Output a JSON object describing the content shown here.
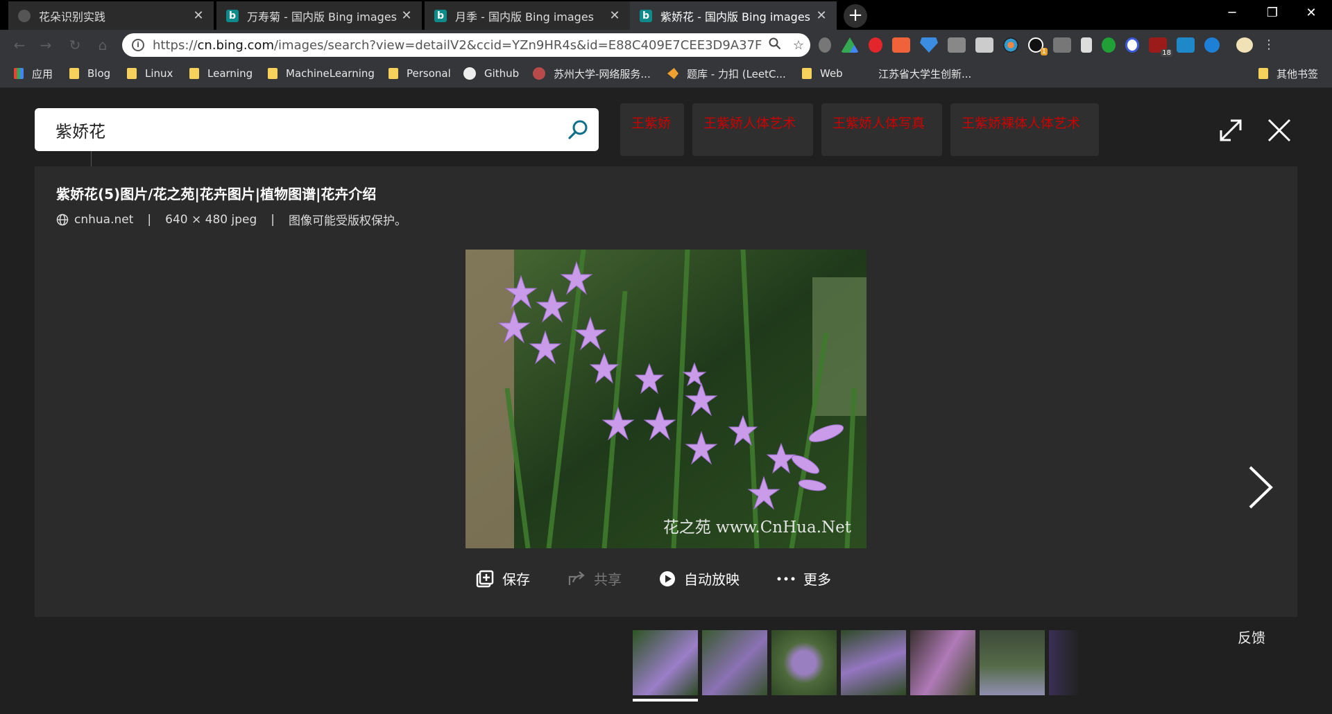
{
  "tabs": [
    {
      "title": "花朵识别实践",
      "icon": "blank-page-icon",
      "active": false
    },
    {
      "title": "万寿菊 - 国内版 Bing images",
      "icon": "bing-icon",
      "active": false
    },
    {
      "title": "月季 - 国内版 Bing images",
      "icon": "bing-icon",
      "active": false
    },
    {
      "title": "紫娇花 - 国内版 Bing images",
      "icon": "bing-icon",
      "active": true
    }
  ],
  "window": {
    "minimize": "─",
    "restore": "❐",
    "close": "✕"
  },
  "omnibox": {
    "url_scheme": "https://",
    "url_host": "cn.bing.com",
    "url_rest": "/images/search?view=detailV2&ccid=YZn9HR4s&id=E88C409E7CEE3D9A37FB8F..."
  },
  "extensions_badges": {
    "notify": "1",
    "ublock": "18"
  },
  "bookmarks": [
    {
      "label": "应用",
      "icon": "apps-icon"
    },
    {
      "label": "Blog",
      "icon": "folder-icon"
    },
    {
      "label": "Linux",
      "icon": "folder-icon"
    },
    {
      "label": "Learning",
      "icon": "folder-icon"
    },
    {
      "label": "MachineLearning",
      "icon": "folder-icon"
    },
    {
      "label": "Personal",
      "icon": "folder-icon"
    },
    {
      "label": "Github",
      "icon": "github-icon"
    },
    {
      "label": "苏州大学-网络服务...",
      "icon": "globe-icon"
    },
    {
      "label": "题库 - 力扣 (LeetC...",
      "icon": "leetcode-icon"
    },
    {
      "label": "Web",
      "icon": "folder-icon"
    },
    {
      "label": "江苏省大学生创新...",
      "icon": "blank-icon"
    },
    {
      "label": "其他书签",
      "icon": "folder-icon"
    }
  ],
  "search": {
    "query": "紫娇花"
  },
  "related_chips": [
    "王紫娇",
    "王紫娇人体艺术",
    "王紫娇人体写真",
    "王紫娇裸体人体艺术"
  ],
  "detail": {
    "title": "紫娇花(5)图片/花之苑|花卉图片|植物图谱|花卉介绍",
    "source": "cnhua.net",
    "sep1": "|",
    "dimensions": "640 × 480 jpeg",
    "sep2": "|",
    "copyright": "图像可能受版权保护。",
    "watermark": "花之苑 www.CnHua.Net"
  },
  "actions": {
    "save": "保存",
    "share": "共享",
    "slideshow": "自动放映",
    "more": "更多"
  },
  "feedback": "反馈",
  "colors": {
    "chip_text": "#cc0000",
    "accent": "#0f8a8a",
    "panel": "#2b2b2b"
  }
}
